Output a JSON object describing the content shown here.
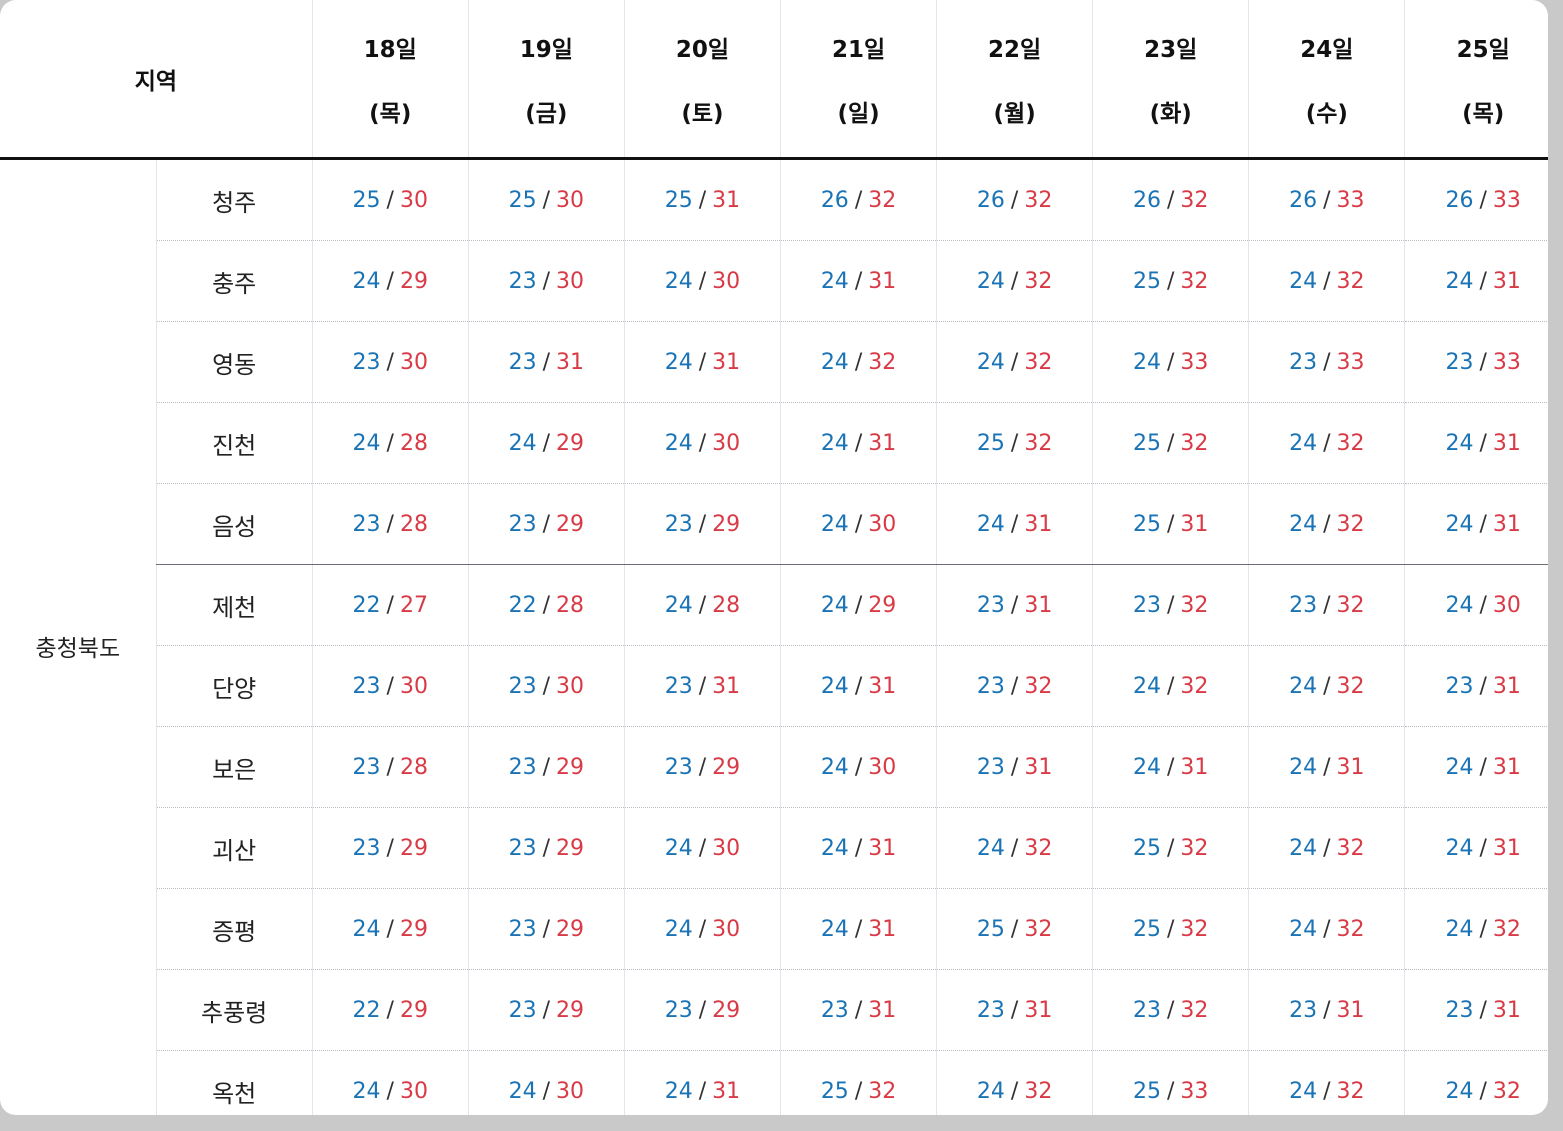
{
  "header": {
    "region_label": "지역",
    "days": [
      {
        "date": "18일",
        "dow": "(목)"
      },
      {
        "date": "19일",
        "dow": "(금)"
      },
      {
        "date": "20일",
        "dow": "(토)"
      },
      {
        "date": "21일",
        "dow": "(일)"
      },
      {
        "date": "22일",
        "dow": "(월)"
      },
      {
        "date": "23일",
        "dow": "(화)"
      },
      {
        "date": "24일",
        "dow": "(수)"
      },
      {
        "date": "25일",
        "dow": "(목)"
      }
    ]
  },
  "province": "충청북도",
  "separator": "/",
  "colors": {
    "low": "#1a73b5",
    "high": "#d83a46"
  },
  "rows": [
    {
      "city": "청주",
      "temps": [
        [
          "25",
          "30"
        ],
        [
          "25",
          "30"
        ],
        [
          "25",
          "31"
        ],
        [
          "26",
          "32"
        ],
        [
          "26",
          "32"
        ],
        [
          "26",
          "32"
        ],
        [
          "26",
          "33"
        ],
        [
          "26",
          "33"
        ]
      ]
    },
    {
      "city": "충주",
      "temps": [
        [
          "24",
          "29"
        ],
        [
          "23",
          "30"
        ],
        [
          "24",
          "30"
        ],
        [
          "24",
          "31"
        ],
        [
          "24",
          "32"
        ],
        [
          "25",
          "32"
        ],
        [
          "24",
          "32"
        ],
        [
          "24",
          "31"
        ]
      ]
    },
    {
      "city": "영동",
      "temps": [
        [
          "23",
          "30"
        ],
        [
          "23",
          "31"
        ],
        [
          "24",
          "31"
        ],
        [
          "24",
          "32"
        ],
        [
          "24",
          "32"
        ],
        [
          "24",
          "33"
        ],
        [
          "23",
          "33"
        ],
        [
          "23",
          "33"
        ]
      ]
    },
    {
      "city": "진천",
      "temps": [
        [
          "24",
          "28"
        ],
        [
          "24",
          "29"
        ],
        [
          "24",
          "30"
        ],
        [
          "24",
          "31"
        ],
        [
          "25",
          "32"
        ],
        [
          "25",
          "32"
        ],
        [
          "24",
          "32"
        ],
        [
          "24",
          "31"
        ]
      ]
    },
    {
      "city": "음성",
      "temps": [
        [
          "23",
          "28"
        ],
        [
          "23",
          "29"
        ],
        [
          "23",
          "29"
        ],
        [
          "24",
          "30"
        ],
        [
          "24",
          "31"
        ],
        [
          "25",
          "31"
        ],
        [
          "24",
          "32"
        ],
        [
          "24",
          "31"
        ]
      ]
    },
    {
      "city": "제천",
      "temps": [
        [
          "22",
          "27"
        ],
        [
          "22",
          "28"
        ],
        [
          "24",
          "28"
        ],
        [
          "24",
          "29"
        ],
        [
          "23",
          "31"
        ],
        [
          "23",
          "32"
        ],
        [
          "23",
          "32"
        ],
        [
          "24",
          "30"
        ]
      ]
    },
    {
      "city": "단양",
      "temps": [
        [
          "23",
          "30"
        ],
        [
          "23",
          "30"
        ],
        [
          "23",
          "31"
        ],
        [
          "24",
          "31"
        ],
        [
          "23",
          "32"
        ],
        [
          "24",
          "32"
        ],
        [
          "24",
          "32"
        ],
        [
          "23",
          "31"
        ]
      ]
    },
    {
      "city": "보은",
      "temps": [
        [
          "23",
          "28"
        ],
        [
          "23",
          "29"
        ],
        [
          "23",
          "29"
        ],
        [
          "24",
          "30"
        ],
        [
          "23",
          "31"
        ],
        [
          "24",
          "31"
        ],
        [
          "24",
          "31"
        ],
        [
          "24",
          "31"
        ]
      ]
    },
    {
      "city": "괴산",
      "temps": [
        [
          "23",
          "29"
        ],
        [
          "23",
          "29"
        ],
        [
          "24",
          "30"
        ],
        [
          "24",
          "31"
        ],
        [
          "24",
          "32"
        ],
        [
          "25",
          "32"
        ],
        [
          "24",
          "32"
        ],
        [
          "24",
          "31"
        ]
      ]
    },
    {
      "city": "증평",
      "temps": [
        [
          "24",
          "29"
        ],
        [
          "23",
          "29"
        ],
        [
          "24",
          "30"
        ],
        [
          "24",
          "31"
        ],
        [
          "25",
          "32"
        ],
        [
          "25",
          "32"
        ],
        [
          "24",
          "32"
        ],
        [
          "24",
          "32"
        ]
      ]
    },
    {
      "city": "추풍령",
      "temps": [
        [
          "22",
          "29"
        ],
        [
          "23",
          "29"
        ],
        [
          "23",
          "29"
        ],
        [
          "23",
          "31"
        ],
        [
          "23",
          "31"
        ],
        [
          "23",
          "32"
        ],
        [
          "23",
          "31"
        ],
        [
          "23",
          "31"
        ]
      ]
    },
    {
      "city": "옥천",
      "temps": [
        [
          "24",
          "30"
        ],
        [
          "24",
          "30"
        ],
        [
          "24",
          "31"
        ],
        [
          "25",
          "32"
        ],
        [
          "24",
          "32"
        ],
        [
          "25",
          "33"
        ],
        [
          "24",
          "32"
        ],
        [
          "24",
          "32"
        ]
      ]
    }
  ]
}
